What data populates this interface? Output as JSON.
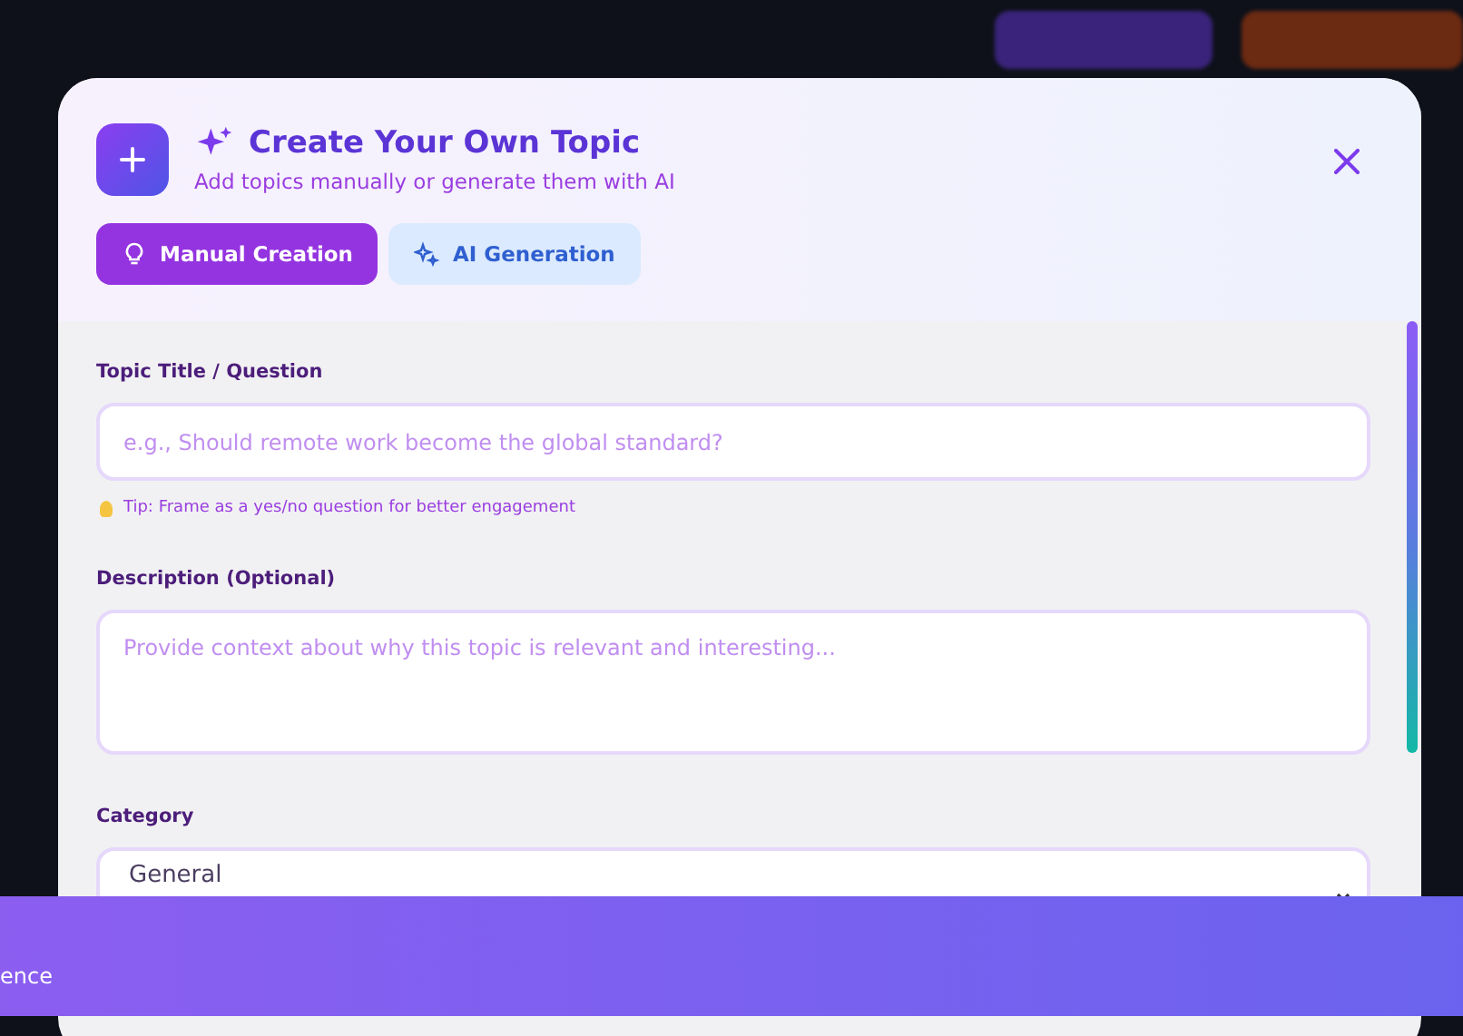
{
  "modal": {
    "title": "Create Your Own Topic",
    "subtitle": "Add topics manually or generate them with AI",
    "tabs": [
      {
        "label": "Manual Creation",
        "selected": true
      },
      {
        "label": "AI Generation",
        "selected": false
      }
    ],
    "fields": [
      {
        "kind": "input",
        "label": "Topic Title / Question",
        "placeholder": "e.g., Should remote work become the global standard?",
        "tip": "Tip: Frame as a yes/no question for better engagement"
      },
      {
        "kind": "textarea",
        "label": "Description (Optional)",
        "placeholder": "Provide context about why this topic is relevant and interesting..."
      },
      {
        "kind": "select",
        "label": "Category",
        "value": "General"
      }
    ]
  },
  "footer_bar": {
    "text": "ence"
  }
}
